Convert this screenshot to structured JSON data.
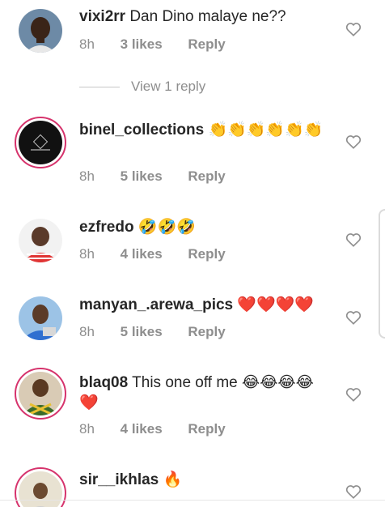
{
  "comments": [
    {
      "username": "vixi2rr",
      "text": "Dan Dino malaye ne??",
      "emoji": "",
      "time": "8h",
      "likes": "3 likes",
      "reply": "Reply",
      "view_replies": "View 1 reply"
    },
    {
      "username": "binel_collections",
      "text": "",
      "emoji": "👏👏👏👏👏👏",
      "time": "8h",
      "likes": "5 likes",
      "reply": "Reply"
    },
    {
      "username": "ezfredo",
      "text": "",
      "emoji": "🤣🤣🤣",
      "time": "8h",
      "likes": "4 likes",
      "reply": "Reply"
    },
    {
      "username": "manyan_.arewa_pics",
      "text": "",
      "emoji": "❤️❤️❤️❤️",
      "time": "8h",
      "likes": "5 likes",
      "reply": "Reply"
    },
    {
      "username": "blaq08",
      "text": "This one off me",
      "emoji": "😂😂😂😂❤️",
      "time": "8h",
      "likes": "4 likes",
      "reply": "Reply"
    },
    {
      "username": "sir__ikhlas",
      "text": "",
      "emoji": "🔥"
    }
  ],
  "colors": {
    "text_primary": "#262626",
    "text_secondary": "#8e8e8e",
    "story_ring": "#d6336c"
  }
}
